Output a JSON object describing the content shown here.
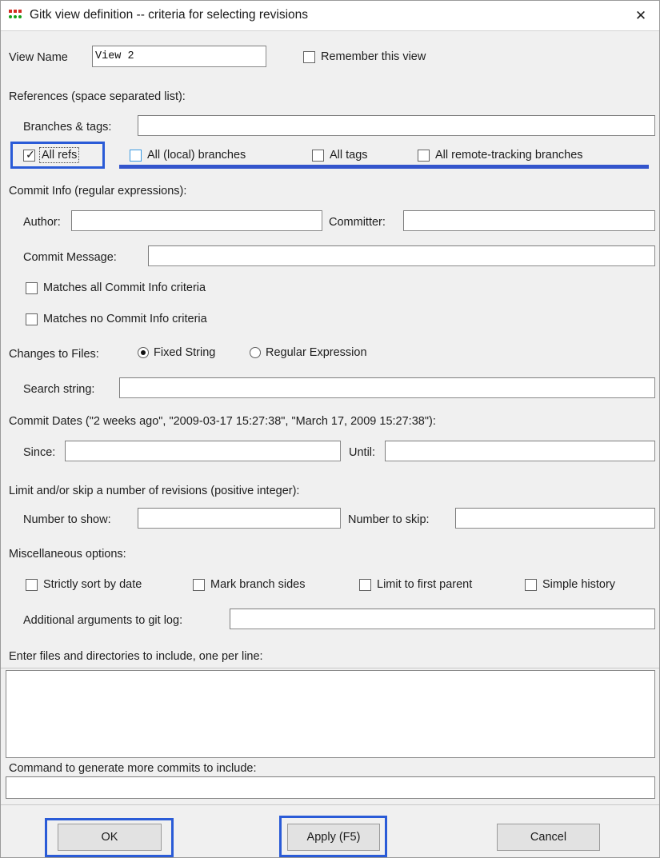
{
  "window": {
    "title": "Gitk view definition -- criteria for selecting revisions",
    "icon": "gitk-dots-icon",
    "close_label": "✕"
  },
  "view": {
    "name_label": "View Name",
    "name_value": "View 2",
    "remember_label": "Remember this view",
    "remember_checked": false
  },
  "references": {
    "section_label": "References (space separated list):",
    "branches_tags_label": "Branches & tags:",
    "branches_tags_value": "",
    "checkboxes": [
      {
        "label": "All refs",
        "checked": true,
        "focused": true,
        "highlighted": true
      },
      {
        "label": "All (local) branches",
        "checked": false,
        "focused": false,
        "highlighted": false
      },
      {
        "label": "All tags",
        "checked": false,
        "focused": false,
        "highlighted": false
      },
      {
        "label": "All remote-tracking branches",
        "checked": false,
        "focused": false,
        "highlighted": false
      }
    ]
  },
  "commit_info": {
    "section_label": "Commit Info (regular expressions):",
    "author_label": "Author:",
    "author_value": "",
    "committer_label": "Committer:",
    "committer_value": "",
    "message_label": "Commit Message:",
    "message_value": "",
    "matches_all_label": "Matches all Commit Info criteria",
    "matches_all_checked": false,
    "matches_no_label": "Matches no Commit Info criteria",
    "matches_no_checked": false
  },
  "changes_to_files": {
    "label": "Changes to Files:",
    "options": [
      {
        "label": "Fixed String",
        "selected": true
      },
      {
        "label": "Regular Expression",
        "selected": false
      }
    ],
    "search_string_label": "Search string:",
    "search_string_value": ""
  },
  "commit_dates": {
    "section_label": "Commit Dates (\"2 weeks ago\", \"2009-03-17 15:27:38\", \"March 17, 2009 15:27:38\"):",
    "since_label": "Since:",
    "since_value": "",
    "until_label": "Until:",
    "until_value": ""
  },
  "limit_skip": {
    "section_label": "Limit and/or skip a number of revisions (positive integer):",
    "show_label": "Number to show:",
    "show_value": "",
    "skip_label": "Number to skip:",
    "skip_value": ""
  },
  "misc": {
    "section_label": "Miscellaneous options:",
    "checkboxes": [
      {
        "label": "Strictly sort by date",
        "checked": false
      },
      {
        "label": "Mark branch sides",
        "checked": false
      },
      {
        "label": "Limit to first parent",
        "checked": false
      },
      {
        "label": "Simple history",
        "checked": false
      }
    ],
    "args_label": "Additional arguments to git log:",
    "args_value": ""
  },
  "files": {
    "section_label": "Enter files and directories to include, one per line:",
    "value": ""
  },
  "command": {
    "section_label": "Command to generate more commits to include:",
    "value": ""
  },
  "buttons": {
    "ok": "OK",
    "apply": "Apply (F5)",
    "cancel": "Cancel",
    "ok_highlighted": true,
    "apply_highlighted": true,
    "cancel_highlighted": false
  },
  "colors": {
    "highlight": "#2a5bd7",
    "underline_bar": "#3355cc",
    "dialog_bg": "#f0f0f0",
    "field_bg": "#ffffff"
  }
}
